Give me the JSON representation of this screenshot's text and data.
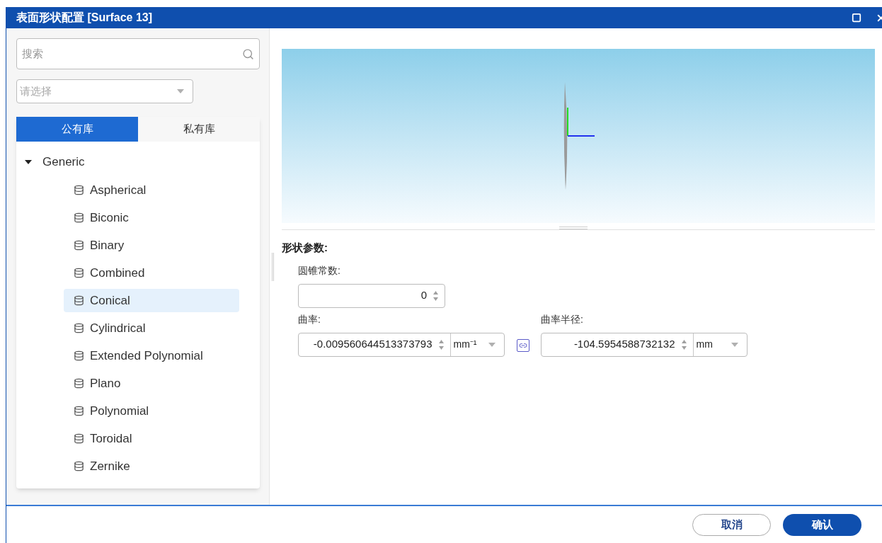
{
  "window": {
    "title": "表面形状配置 [Surface 13]"
  },
  "search": {
    "placeholder": "搜索"
  },
  "filter": {
    "placeholder": "请选择"
  },
  "tabs": [
    {
      "label": "公有库",
      "selected": true
    },
    {
      "label": "私有库",
      "selected": false
    }
  ],
  "tree": [
    {
      "label": "Generic",
      "expanded": true,
      "children": [
        {
          "label": "Aspherical",
          "selected": false
        },
        {
          "label": "Biconic",
          "selected": false
        },
        {
          "label": "Binary",
          "selected": false
        },
        {
          "label": "Combined",
          "selected": false
        },
        {
          "label": "Conical",
          "selected": true
        },
        {
          "label": "Cylindrical",
          "selected": false
        },
        {
          "label": "Extended Polynomial",
          "selected": false
        },
        {
          "label": "Plano",
          "selected": false
        },
        {
          "label": "Polynomial",
          "selected": false
        },
        {
          "label": "Toroidal",
          "selected": false
        },
        {
          "label": "Zernike",
          "selected": false
        }
      ]
    }
  ],
  "params": {
    "title": "形状参数:",
    "conic": {
      "label": "圆锥常数:",
      "value": "0"
    },
    "curvature": {
      "label": "曲率:",
      "value": "-0.009560644513373793",
      "unit": "mm⁻¹"
    },
    "radius": {
      "label": "曲率半径:",
      "value": "-104.5954588732132",
      "unit": "mm"
    }
  },
  "buttons": [
    {
      "label": "取消",
      "kind": "secondary"
    },
    {
      "label": "确认",
      "kind": "primary"
    }
  ]
}
